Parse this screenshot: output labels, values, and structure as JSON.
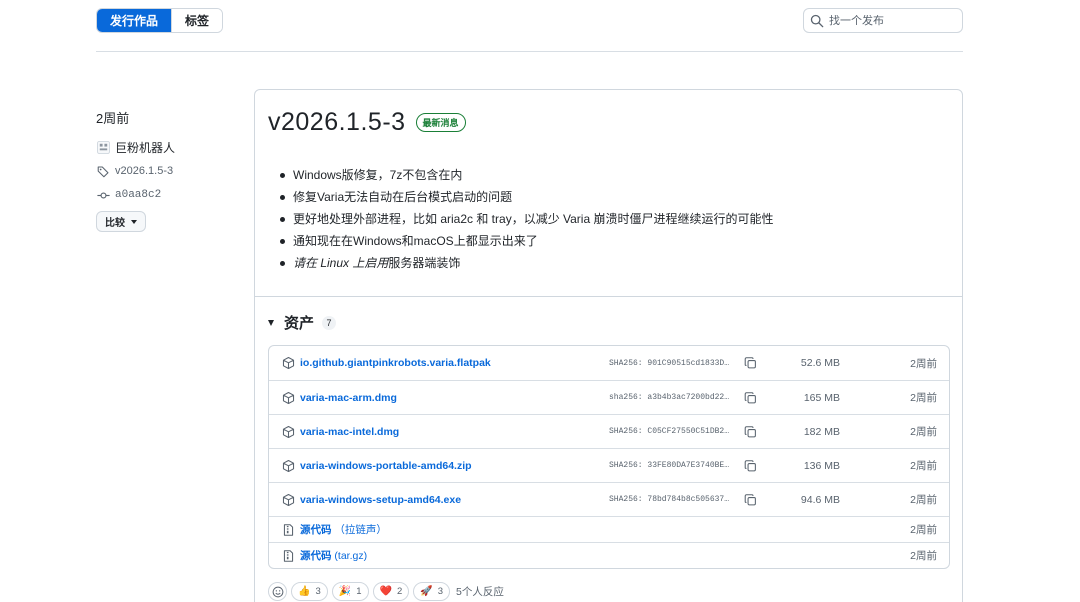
{
  "tabs": {
    "releases": "发行作品",
    "tags": "标签"
  },
  "search": {
    "placeholder": "找一个发布"
  },
  "sidebar": {
    "time": "2周前",
    "author": "巨粉机器人",
    "tag": "v2026.1.5-3",
    "commit": "a0aa8c2",
    "compare": "比较"
  },
  "release": {
    "title": "v2026.1.5-3",
    "badge": "最新消息",
    "notes": [
      "Windows版修复，7z不包含在内",
      "修复Varia无法自动在后台模式启动的问题",
      "更好地处理外部进程，比如 aria2c 和 tray，以减少 Varia 崩溃时僵尸进程继续运行的可能性",
      "通知现在在Windows和macOS上都显示出来了"
    ],
    "note5_italic": "请在 Linux 上启用",
    "note5_rest": "服务器端装饰"
  },
  "assets": {
    "heading": "资产",
    "count": "7",
    "files": [
      {
        "name": "io.github.giantpinkrobots.varia.flatpak",
        "sha": "SHA256: 901C90515cd1833D…",
        "size": "52.6 MB",
        "date": "2周前"
      },
      {
        "name": "varia-mac-arm.dmg",
        "sha": "sha256: a3b4b3ac7200bd22…",
        "size": "165 MB",
        "date": "2周前"
      },
      {
        "name": "varia-mac-intel.dmg",
        "sha": "SHA256: C05CF27550C51DB2…",
        "size": "182 MB",
        "date": "2周前"
      },
      {
        "name": "varia-windows-portable-amd64.zip",
        "sha": "SHA256: 33FE80DA7E3740BE…",
        "size": "136 MB",
        "date": "2周前"
      },
      {
        "name": "varia-windows-setup-amd64.exe",
        "sha": "SHA256: 78bd784b8c505637…",
        "size": "94.6 MB",
        "date": "2周前"
      }
    ],
    "sources": [
      {
        "label": "源代码",
        "format": "（拉链声）",
        "date": "2周前"
      },
      {
        "label": "源代码",
        "format": "(tar.gz)",
        "date": "2周前"
      }
    ]
  },
  "reactions": {
    "items": [
      {
        "emoji": "👍",
        "count": "3"
      },
      {
        "emoji": "🎉",
        "count": "1"
      },
      {
        "emoji": "❤️",
        "count": "2"
      },
      {
        "emoji": "🚀",
        "count": "3"
      }
    ],
    "summary": "5个人反应"
  },
  "colors": {
    "accent": "#0969da",
    "latest_badge": "#1a7f37",
    "muted": "#59636e",
    "border": "#d0d7de"
  },
  "icons": [
    "search-icon",
    "avatar",
    "tag-icon",
    "commit-icon",
    "package-icon",
    "copy-icon",
    "file-zip-icon",
    "smiley-icon"
  ]
}
